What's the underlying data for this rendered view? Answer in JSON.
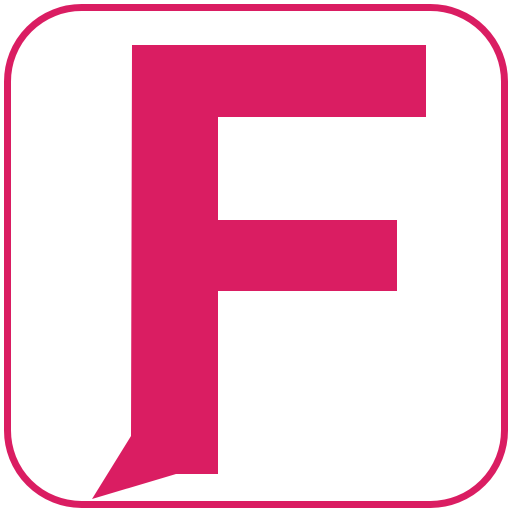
{
  "icon": {
    "name": "letter-f-speech-bubble-logo",
    "letter": "F",
    "colors": {
      "accent": "#DA1D62",
      "background": "#FFFFFF"
    }
  }
}
